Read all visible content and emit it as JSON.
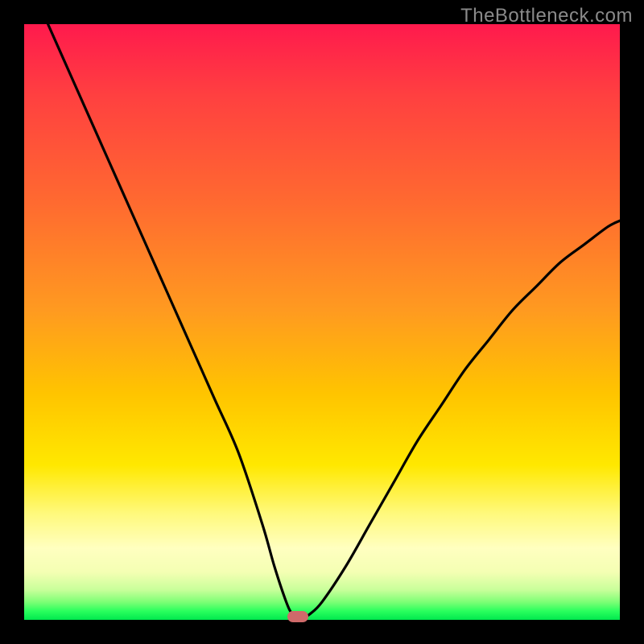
{
  "watermark": "TheBottleneck.com",
  "chart_data": {
    "type": "line",
    "title": "",
    "xlabel": "",
    "ylabel": "",
    "xlim": [
      0,
      100
    ],
    "ylim": [
      0,
      100
    ],
    "grid": false,
    "legend": false,
    "series": [
      {
        "name": "bottleneck-curve",
        "x": [
          4,
          8,
          12,
          16,
          20,
          24,
          28,
          32,
          36,
          40,
          42,
          44,
          45,
          46,
          47,
          48,
          50,
          54,
          58,
          62,
          66,
          70,
          74,
          78,
          82,
          86,
          90,
          94,
          98,
          100
        ],
        "y": [
          100,
          91,
          82,
          73,
          64,
          55,
          46,
          37,
          28,
          16,
          9,
          3,
          1,
          0.5,
          0.5,
          1,
          3,
          9,
          16,
          23,
          30,
          36,
          42,
          47,
          52,
          56,
          60,
          63,
          66,
          67
        ]
      }
    ],
    "annotations": [
      {
        "name": "min-marker",
        "x": 46,
        "y": 0.5,
        "shape": "pill",
        "color": "#cf6a6a"
      }
    ],
    "background_gradient": {
      "top": "#ff1a4d",
      "mid": "#ffe800",
      "bottom": "#00e84e"
    }
  }
}
